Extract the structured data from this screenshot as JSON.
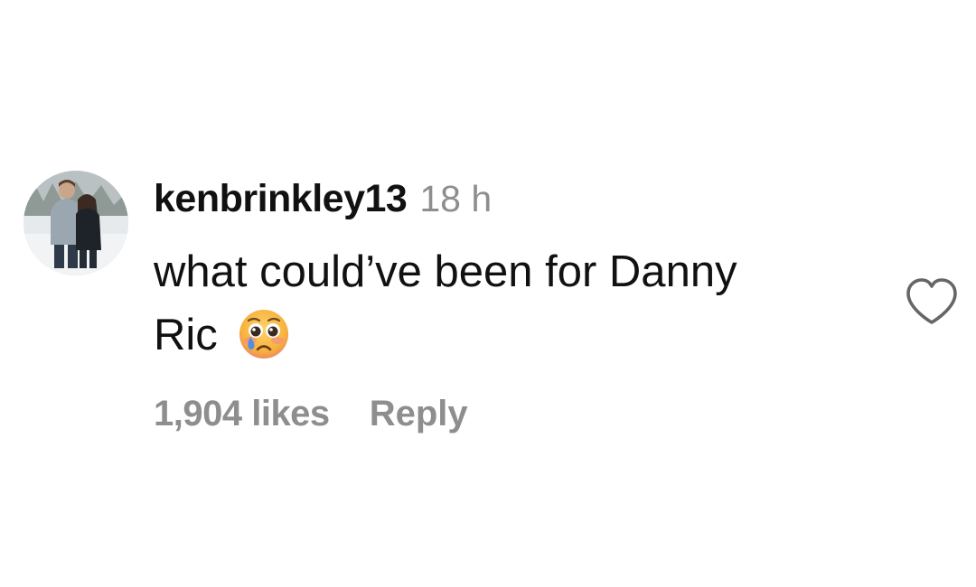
{
  "comment": {
    "username": "kenbrinkley13",
    "timestamp": "18 h",
    "text_line1": "what could’ve been for Danny",
    "text_line2": "Ric",
    "emoji_icon": "pleading-face-tear-icon",
    "likes": "1,904 likes",
    "reply_label": "Reply",
    "like_icon": "heart-outline-icon"
  },
  "colors": {
    "primary_text": "#111111",
    "secondary_text": "#8e8e8e",
    "icon_stroke": "#666666"
  }
}
